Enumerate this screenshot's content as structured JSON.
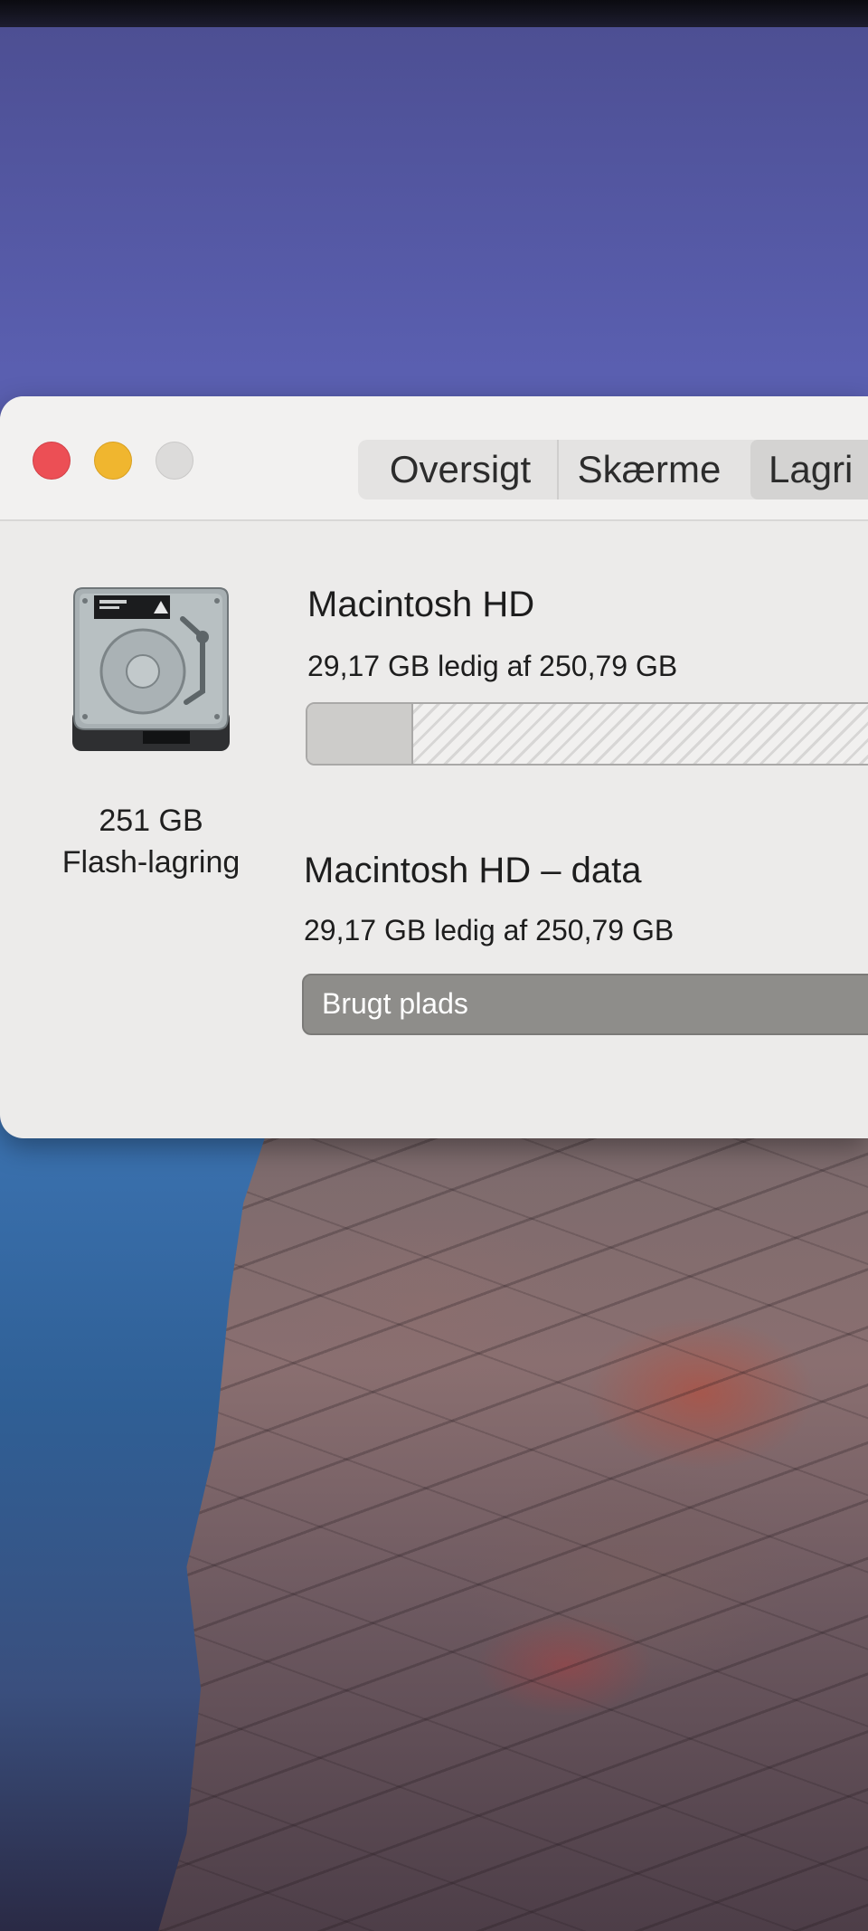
{
  "tabs": [
    {
      "label": "Oversigt"
    },
    {
      "label": "Skærme"
    },
    {
      "label": "Lagri"
    }
  ],
  "disk": {
    "icon": "hard-drive-icon",
    "capacity": "251 GB",
    "type": "Flash-lagring"
  },
  "volumes": [
    {
      "name": "Macintosh HD",
      "summary": "29,17 GB ledig af 250,79 GB",
      "used_fraction": 0.18
    },
    {
      "name": "Macintosh HD – data",
      "summary": "29,17 GB ledig af 250,79 GB",
      "bar_label": "Brugt plads"
    }
  ],
  "colors": {
    "close": "#ec4f55",
    "minimize": "#f0b62f",
    "zoom": "#dcdbda"
  }
}
